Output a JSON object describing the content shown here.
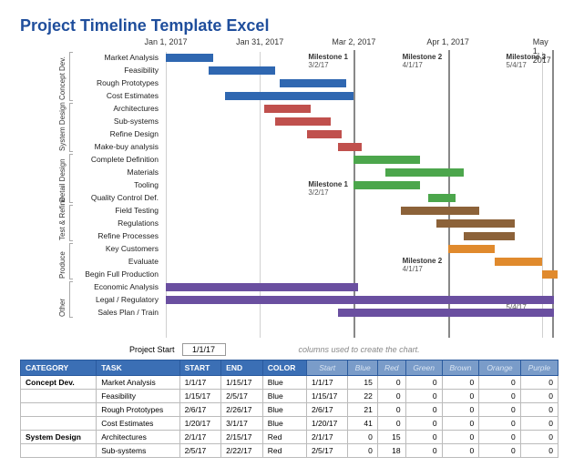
{
  "title": "Project Timeline Template Excel",
  "project_start_label": "Project Start",
  "project_start_value": "1/1/17",
  "hidden_cols_note": "columns used to create the chart.",
  "chart_data": {
    "type": "gantt",
    "x_axis": {
      "min": "2017-01-01",
      "max": "2017-05-06",
      "ticks": [
        {
          "label": "Jan 1, 2017",
          "pos": 0.0
        },
        {
          "label": "Jan 31, 2017",
          "pos": 0.24
        },
        {
          "label": "Mar 2, 2017",
          "pos": 0.48
        },
        {
          "label": "Apr 1, 2017",
          "pos": 0.72
        },
        {
          "label": "May 1, 2017",
          "pos": 0.96
        }
      ]
    },
    "milestones": [
      {
        "name": "Milestone 1",
        "date": "3/2/17",
        "pos": 0.48
      },
      {
        "name": "Milestone 2",
        "date": "4/1/17",
        "pos": 0.72
      },
      {
        "name": "Milestone 3",
        "date": "5/4/17",
        "pos": 0.985
      },
      {
        "name": "Milestone 1",
        "date": "3/2/17",
        "pos": 0.48,
        "row": 10
      },
      {
        "name": "Milestone 2",
        "date": "4/1/17",
        "pos": 0.72,
        "row": 16
      },
      {
        "name": "Milestone 3",
        "date": "5/4/17",
        "pos": 0.985,
        "row": 19
      }
    ],
    "groups": [
      {
        "name": "Concept Dev.",
        "rows": [
          0,
          3
        ]
      },
      {
        "name": "System Design",
        "rows": [
          4,
          7
        ]
      },
      {
        "name": "Detail Design",
        "rows": [
          8,
          11
        ]
      },
      {
        "name": "Test & Refine",
        "rows": [
          12,
          14
        ]
      },
      {
        "name": "Produce",
        "rows": [
          15,
          17
        ]
      },
      {
        "name": "Other",
        "rows": [
          18,
          20
        ]
      }
    ],
    "tasks": [
      {
        "label": "Market Analysis",
        "color": "blue",
        "start": 0.0,
        "width": 0.12
      },
      {
        "label": "Feasibility",
        "color": "blue",
        "start": 0.11,
        "width": 0.17
      },
      {
        "label": "Rough Prototypes",
        "color": "blue",
        "start": 0.29,
        "width": 0.17
      },
      {
        "label": "Cost Estimates",
        "color": "blue",
        "start": 0.15,
        "width": 0.33
      },
      {
        "label": "Architectures",
        "color": "red",
        "start": 0.25,
        "width": 0.12
      },
      {
        "label": "Sub-systems",
        "color": "red",
        "start": 0.28,
        "width": 0.14
      },
      {
        "label": "Refine Design",
        "color": "red",
        "start": 0.36,
        "width": 0.09
      },
      {
        "label": "Make-buy analysis",
        "color": "red",
        "start": 0.44,
        "width": 0.06
      },
      {
        "label": "Complete Definition",
        "color": "green",
        "start": 0.48,
        "width": 0.17
      },
      {
        "label": "Materials",
        "color": "green",
        "start": 0.56,
        "width": 0.2
      },
      {
        "label": "Tooling",
        "color": "green",
        "start": 0.48,
        "width": 0.17
      },
      {
        "label": "Quality Control Def.",
        "color": "green",
        "start": 0.67,
        "width": 0.07
      },
      {
        "label": "Field Testing",
        "color": "brown",
        "start": 0.6,
        "width": 0.2
      },
      {
        "label": "Regulations",
        "color": "brown",
        "start": 0.69,
        "width": 0.2
      },
      {
        "label": "Refine Processes",
        "color": "brown",
        "start": 0.76,
        "width": 0.13
      },
      {
        "label": "Key Customers",
        "color": "orange",
        "start": 0.72,
        "width": 0.12
      },
      {
        "label": "Evaluate",
        "color": "orange",
        "start": 0.84,
        "width": 0.12
      },
      {
        "label": "Begin Full Production",
        "color": "orange",
        "start": 0.96,
        "width": 0.04
      },
      {
        "label": "Economic Analysis",
        "color": "purple",
        "start": 0.0,
        "width": 0.49
      },
      {
        "label": "Legal / Regulatory",
        "color": "purple",
        "start": 0.0,
        "width": 0.99
      },
      {
        "label": "Sales Plan / Train",
        "color": "purple",
        "start": 0.44,
        "width": 0.55
      }
    ]
  },
  "table": {
    "headers": [
      "CATEGORY",
      "TASK",
      "START",
      "END",
      "COLOR"
    ],
    "hidden_headers": [
      "Start",
      "Blue",
      "Red",
      "Green",
      "Brown",
      "Orange",
      "Purple"
    ],
    "rows": [
      {
        "cat": "Concept Dev.",
        "task": "Market Analysis",
        "start": "1/1/17",
        "end": "1/15/17",
        "color": "Blue",
        "hstart": "1/1/17",
        "vals": [
          15,
          0,
          0,
          0,
          0,
          0
        ]
      },
      {
        "cat": "",
        "task": "Feasibility",
        "start": "1/15/17",
        "end": "2/5/17",
        "color": "Blue",
        "hstart": "1/15/17",
        "vals": [
          22,
          0,
          0,
          0,
          0,
          0
        ]
      },
      {
        "cat": "",
        "task": "Rough Prototypes",
        "start": "2/6/17",
        "end": "2/26/17",
        "color": "Blue",
        "hstart": "2/6/17",
        "vals": [
          21,
          0,
          0,
          0,
          0,
          0
        ]
      },
      {
        "cat": "",
        "task": "Cost Estimates",
        "start": "1/20/17",
        "end": "3/1/17",
        "color": "Blue",
        "hstart": "1/20/17",
        "vals": [
          41,
          0,
          0,
          0,
          0,
          0
        ]
      },
      {
        "cat": "System Design",
        "task": "Architectures",
        "start": "2/1/17",
        "end": "2/15/17",
        "color": "Red",
        "hstart": "2/1/17",
        "vals": [
          0,
          15,
          0,
          0,
          0,
          0
        ]
      },
      {
        "cat": "",
        "task": "Sub-systems",
        "start": "2/5/17",
        "end": "2/22/17",
        "color": "Red",
        "hstart": "2/5/17",
        "vals": [
          0,
          18,
          0,
          0,
          0,
          0
        ]
      }
    ]
  }
}
